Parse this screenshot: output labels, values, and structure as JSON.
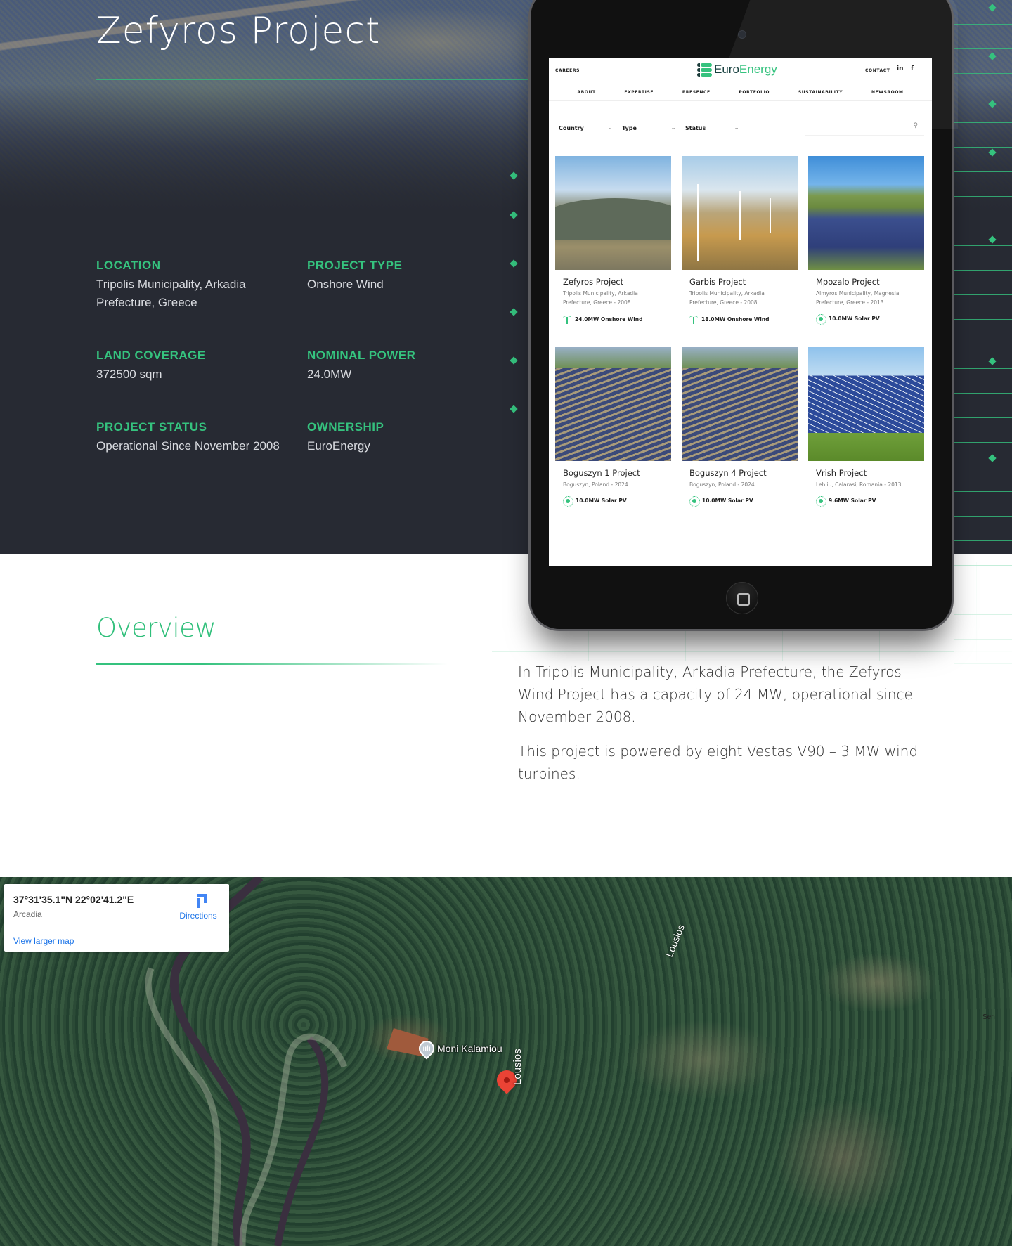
{
  "hero": {
    "title": "Zefyros Project",
    "specs": [
      {
        "label": "LOCATION",
        "value": "Tripolis Municipality, Arkadia Prefecture, Greece"
      },
      {
        "label": "PROJECT TYPE",
        "value": "Onshore Wind"
      },
      {
        "label": "LAND COVERAGE",
        "value": "372500 sqm"
      },
      {
        "label": "NOMINAL POWER",
        "value": "24.0MW"
      },
      {
        "label": "PROJECT STATUS",
        "value": "Operational Since November 2008"
      },
      {
        "label": "OWNERSHIP",
        "value": "EuroEnergy"
      }
    ]
  },
  "tablet": {
    "header": {
      "careers": "CAREERS",
      "logo_part1": "Euro",
      "logo_part2": "Energy",
      "contact": "CONTACT",
      "linkedin_icon": "in",
      "facebook_icon": "f"
    },
    "nav": [
      "ABOUT",
      "EXPERTISE",
      "PRESENCE",
      "PORTFOLIO",
      "SUSTAINABILITY",
      "NEWSROOM"
    ],
    "filters": [
      {
        "label": "Country",
        "chevron": "⌄"
      },
      {
        "label": "Type",
        "chevron": "⌄"
      },
      {
        "label": "Status",
        "chevron": "⌄"
      }
    ],
    "search_icon": "⚲",
    "projects": [
      {
        "title": "Zefyros Project",
        "location": "Tripolis Municipality, Arkadia Prefecture, Greece - 2008",
        "capacity": "24.0MW Onshore Wind",
        "type_icon": "wind-turbine-icon"
      },
      {
        "title": "Garbis Project",
        "location": "Tripolis Municipality, Arkadia Prefecture, Greece - 2008",
        "capacity": "18.0MW Onshore Wind",
        "type_icon": "wind-turbine-icon"
      },
      {
        "title": "Mpozalo Project",
        "location": "Almyros Municipality, Magnesia Prefecture, Greece - 2013",
        "capacity": "10.0MW Solar PV",
        "type_icon": "sun-icon"
      },
      {
        "title": "Boguszyn 1 Project",
        "location": "Boguszyn, Poland - 2024",
        "capacity": "10.0MW Solar PV",
        "type_icon": "sun-icon"
      },
      {
        "title": "Boguszyn 4 Project",
        "location": "Boguszyn, Poland - 2024",
        "capacity": "10.0MW Solar PV",
        "type_icon": "sun-icon"
      },
      {
        "title": "Vrish Project",
        "location": "Lehliu, Calarasi, Romania - 2013",
        "capacity": "9.6MW Solar PV",
        "type_icon": "sun-icon"
      }
    ]
  },
  "overview": {
    "title": "Overview",
    "paragraphs": [
      "In Tripolis Municipality, Arkadia Prefecture, the Zefyros Wind Project has a capacity of 24 MW, operational since November 2008.",
      "This project is powered by eight Vestas V90 – 3 MW wind turbines."
    ]
  },
  "map": {
    "coordinates": "37°31'35.1\"N 22°02'41.2\"E",
    "region": "Arcadia",
    "directions_label": "Directions",
    "view_larger_label": "View larger map",
    "poi_label": "Moni Kalamiou",
    "river_label": "Lousios",
    "edge_label": "Sen"
  },
  "colors": {
    "accent_green": "#35c27e",
    "hero_bg": "#272a33",
    "map_link": "#1a73e8",
    "map_pin": "#ea4335"
  }
}
